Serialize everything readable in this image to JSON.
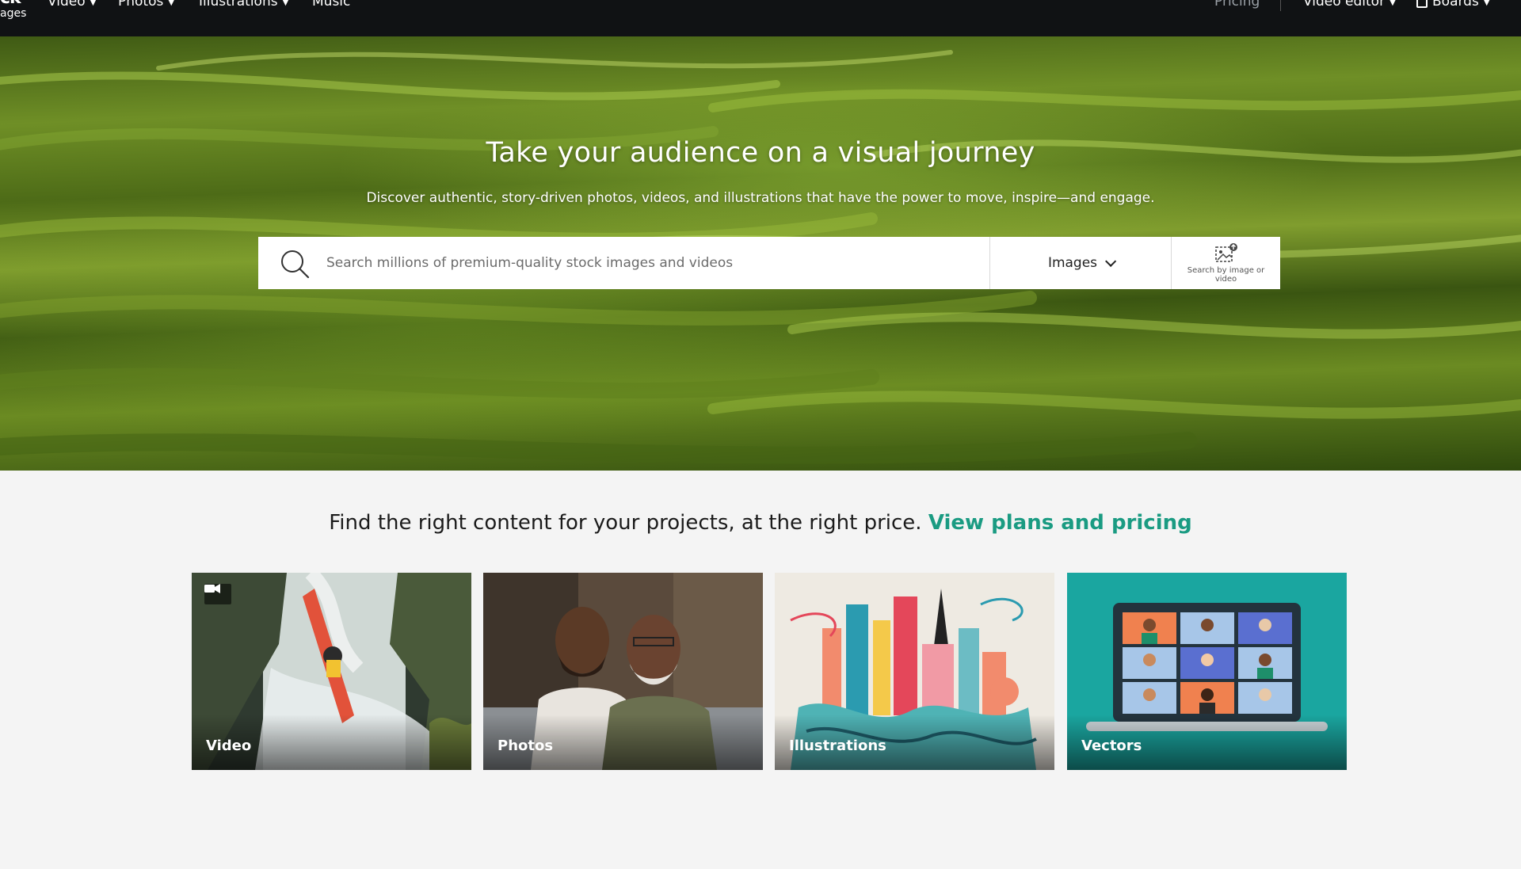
{
  "nav": {
    "logo_big": "ck",
    "logo_small": "ages",
    "items": [
      {
        "label": "Video",
        "has_dropdown": true
      },
      {
        "label": "Photos",
        "has_dropdown": true
      },
      {
        "label": "Illustrations",
        "has_dropdown": true
      },
      {
        "label": "Music",
        "has_dropdown": false
      }
    ],
    "right": {
      "pricing": "Pricing",
      "video_editor": "Video editor",
      "boards": "Boards"
    }
  },
  "hero": {
    "title": "Take your audience on a visual journey",
    "subtitle": "Discover authentic, story-driven photos, videos, and illustrations that have the power to move, inspire—and engage.",
    "search": {
      "placeholder": "Search millions of premium-quality stock images and videos",
      "value": "",
      "type_selected": "Images",
      "image_search_label": "Search by image or video"
    }
  },
  "promo": {
    "text": "Find the right content for your projects, at the right price.",
    "link": "View plans and pricing",
    "link_color": "#1a9b82"
  },
  "categories": [
    {
      "label": "Video",
      "icon": "video-camera-icon"
    },
    {
      "label": "Photos"
    },
    {
      "label": "Illustrations"
    },
    {
      "label": "Vectors"
    }
  ],
  "colors": {
    "nav_bg": "#101214",
    "page_bg": "#f4f4f4",
    "vectors_tile": "#1aa6a0"
  }
}
